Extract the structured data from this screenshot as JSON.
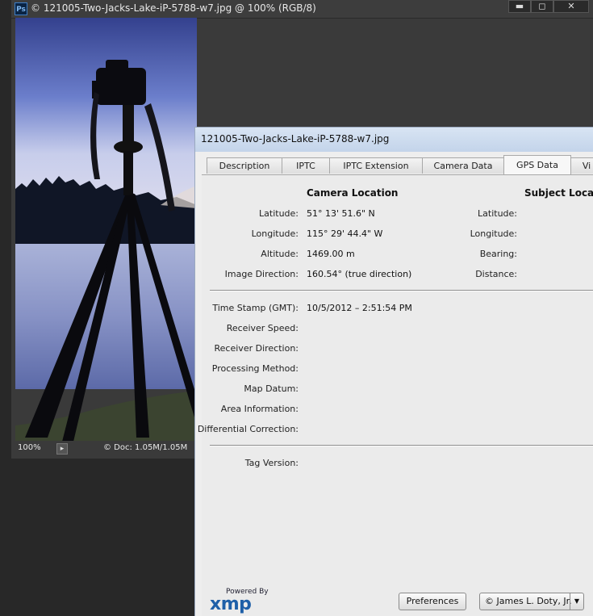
{
  "photoshop": {
    "app_icon": "Ps",
    "title": "© 121005-Two-Jacks-Lake-iP-5788-w7.jpg @ 100% (RGB/8)",
    "window_buttons": {
      "minimize": "▬",
      "maximize": "◻",
      "close": "✕"
    },
    "status": {
      "zoom": "100%",
      "doc": "© Doc: 1.05M/1.05M"
    }
  },
  "dialog": {
    "title": "121005-Two-Jacks-Lake-iP-5788-w7.jpg",
    "tabs": [
      {
        "label": "Description",
        "active": false
      },
      {
        "label": "IPTC",
        "active": false
      },
      {
        "label": "IPTC Extension",
        "active": false
      },
      {
        "label": "Camera Data",
        "active": false
      },
      {
        "label": "GPS Data",
        "active": true
      },
      {
        "label": "Vi",
        "active": false
      }
    ],
    "camera_location": {
      "heading": "Camera Location",
      "latitude_label": "Latitude:",
      "latitude": "51° 13' 51.6\" N",
      "longitude_label": "Longitude:",
      "longitude": "115° 29' 44.4\" W",
      "altitude_label": "Altitude:",
      "altitude": "1469.00 m",
      "direction_label": "Image Direction:",
      "direction": "160.54° (true direction)"
    },
    "subject_location": {
      "heading": "Subject Locati",
      "latitude_label": "Latitude:",
      "longitude_label": "Longitude:",
      "bearing_label": "Bearing:",
      "distance_label": "Distance:"
    },
    "gps_info": {
      "timestamp_label": "Time Stamp (GMT):",
      "timestamp": "10/5/2012 – 2:51:54 PM",
      "receiver_speed_label": "Receiver Speed:",
      "receiver_direction_label": "Receiver Direction:",
      "processing_method_label": "Processing Method:",
      "map_datum_label": "Map Datum:",
      "area_information_label": "Area Information:",
      "differential_correction_label": "Differential Correction:"
    },
    "tag_version_label": "Tag Version:",
    "footer": {
      "powered_by": "Powered By",
      "xmp": "xmp",
      "preferences": "Preferences",
      "template_value": "© James L. Doty, Jr.",
      "dropdown_arrow": "▼"
    }
  }
}
